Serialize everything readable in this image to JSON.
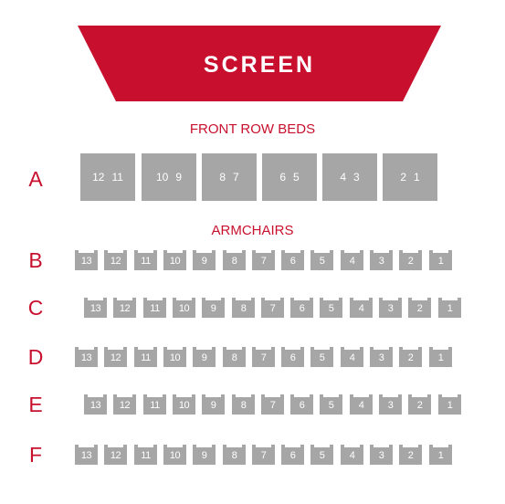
{
  "screen": {
    "label": "SCREEN",
    "color": "#c8102e"
  },
  "sections": {
    "front": "FRONT ROW BEDS",
    "armchairs": "ARMCHAIRS"
  },
  "bed_row": {
    "letter": "A",
    "beds": [
      [
        "12",
        "11"
      ],
      [
        "10",
        "9"
      ],
      [
        "8",
        "7"
      ],
      [
        "6",
        "5"
      ],
      [
        "4",
        "3"
      ],
      [
        "2",
        "1"
      ]
    ]
  },
  "chair_rows": [
    {
      "letter": "B",
      "seats": [
        "13",
        "12",
        "11",
        "10",
        "9",
        "8",
        "7",
        "6",
        "5",
        "4",
        "3",
        "2",
        "1"
      ]
    },
    {
      "letter": "C",
      "seats": [
        "13",
        "12",
        "11",
        "10",
        "9",
        "8",
        "7",
        "6",
        "5",
        "4",
        "3",
        "2",
        "1"
      ]
    },
    {
      "letter": "D",
      "seats": [
        "13",
        "12",
        "11",
        "10",
        "9",
        "8",
        "7",
        "6",
        "5",
        "4",
        "3",
        "2",
        "1"
      ]
    },
    {
      "letter": "E",
      "seats": [
        "13",
        "12",
        "11",
        "10",
        "9",
        "8",
        "7",
        "6",
        "5",
        "4",
        "3",
        "2",
        "1"
      ]
    },
    {
      "letter": "F",
      "seats": [
        "13",
        "12",
        "11",
        "10",
        "9",
        "8",
        "7",
        "6",
        "5",
        "4",
        "3",
        "2",
        "1"
      ]
    }
  ],
  "colors": {
    "accent": "#c8102e",
    "seat": "#a6a6a6",
    "seat_text": "#ffffff"
  }
}
